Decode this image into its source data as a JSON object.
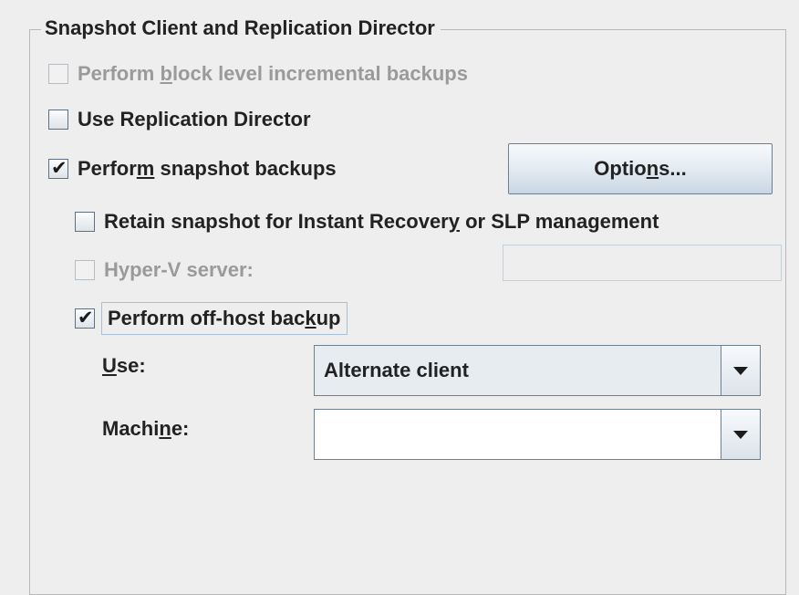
{
  "group": {
    "title": "Snapshot Client and Replication Director"
  },
  "options": {
    "block_level": {
      "pre": "Perform ",
      "mnemonic": "b",
      "post": "lock level incremental backups",
      "checked": false,
      "enabled": false
    },
    "replication_director": {
      "label": "Use Replication Director",
      "checked": false,
      "enabled": true
    },
    "snapshot_backups": {
      "pre": "Perfor",
      "mnemonic": "m",
      "post": " snapshot backups",
      "checked": true,
      "enabled": true
    },
    "retain_snapshot": {
      "pre": "Retain snapshot for Instant Recover",
      "mnemonic": "y",
      "post": " or SLP management",
      "checked": false,
      "enabled": true
    },
    "hyperv": {
      "label": "Hyper-V server:",
      "checked": false,
      "enabled": false,
      "value": ""
    },
    "offhost": {
      "pre": "Perform off-host bac",
      "mnemonic": "k",
      "post": "up",
      "checked": true,
      "enabled": true
    }
  },
  "options_button": {
    "pre": "Optio",
    "mnemonic": "n",
    "post": "s..."
  },
  "use": {
    "label_mnemonic": "U",
    "label_post": "se:",
    "selected": "Alternate client"
  },
  "machine": {
    "label_pre": "Machi",
    "label_mnemonic": "n",
    "label_post": "e:",
    "selected": ""
  },
  "check_glyph": "✔"
}
